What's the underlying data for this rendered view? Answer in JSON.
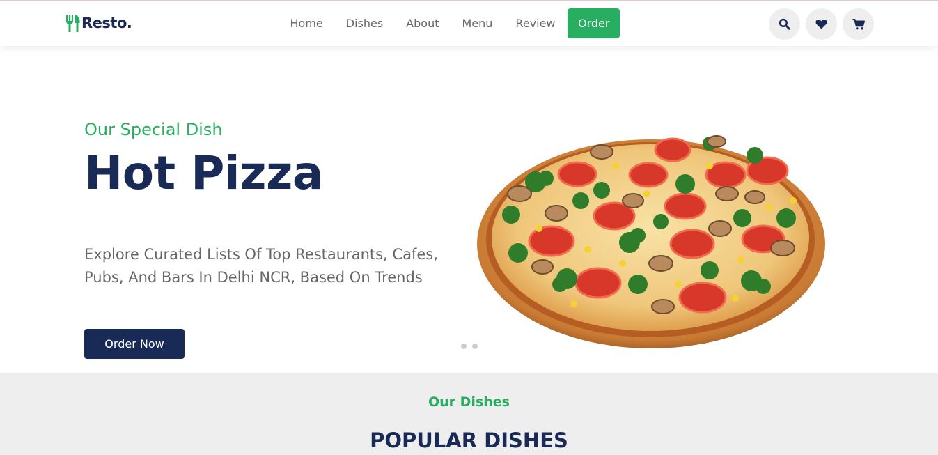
{
  "header": {
    "logo_text": "Resto.",
    "nav": [
      "Home",
      "Dishes",
      "About",
      "Menu",
      "Review",
      "Order"
    ],
    "active_nav": "Order",
    "icons": [
      "search-icon",
      "heart-icon",
      "cart-icon"
    ]
  },
  "hero": {
    "subtitle": "Our Special Dish",
    "title": "Hot Pizza",
    "description": "Explore Curated Lists Of Top Restaurants, Cafes, Pubs, And Bars In Delhi NCR, Based On Trends",
    "button": "Order Now",
    "slide_count": 2
  },
  "dishes_section": {
    "subtitle": "Our Dishes",
    "title": "POPULAR DISHES"
  },
  "colors": {
    "accent": "#27ae60",
    "primary": "#192a56",
    "text_muted": "#666666",
    "light_bg": "#eeeeee"
  }
}
